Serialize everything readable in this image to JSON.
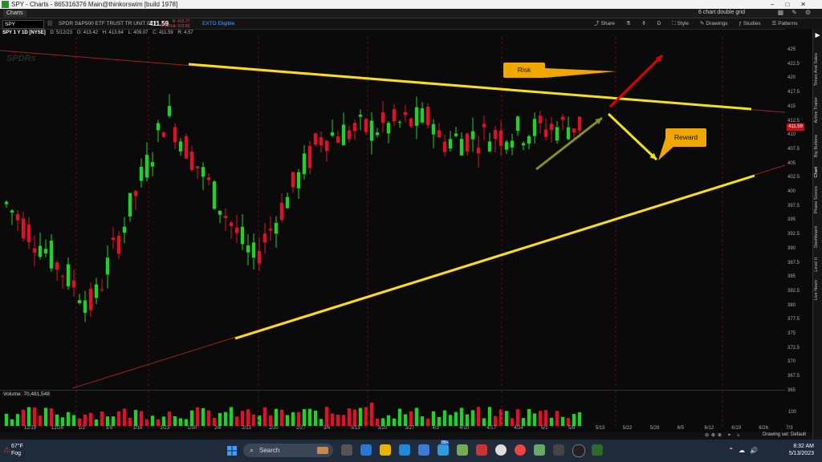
{
  "window": {
    "title": "SPY - Charts - 865316376 Main@thinkorswim [build 1978]",
    "controls": [
      "–",
      "□",
      "✕"
    ]
  },
  "tabs": {
    "active": "Charts",
    "grid_label": "6 chart double grid"
  },
  "toolbar": {
    "symbol": "SPY",
    "description": "SPDR S&P500 ETF TRUST TR UNIT ETF",
    "last_price": "411.59",
    "bid": "B: 410.77",
    "ask": "A: 410.80",
    "change": "-1.13%",
    "ext_label": "EXTO Eligible",
    "share": "Share",
    "period_code": "D",
    "style": "Style",
    "drawings": "Drawings",
    "studies": "Studies",
    "patterns": "Patterns"
  },
  "info_line": {
    "label": "SPY 1 Y 1D [NYSE]",
    "date": "D: 5/12/23",
    "open": "O: 413.42",
    "high": "H: 413.64",
    "low": "L: 409.07",
    "close": "C: 411.59",
    "range": "R: 4.57"
  },
  "watermark": "SPDRs",
  "callouts": {
    "risk": "Risk",
    "reward": "Reward"
  },
  "price_tag": "411.59",
  "y_axis": [
    "425",
    "422.5",
    "420",
    "417.5",
    "415",
    "412.5",
    "410",
    "407.5",
    "405",
    "402.5",
    "400",
    "397.5",
    "395",
    "392.5",
    "390",
    "387.5",
    "385",
    "382.5",
    "380",
    "377.5",
    "375",
    "372.5",
    "370",
    "367.5",
    "365"
  ],
  "volume": {
    "label": "Volume",
    "value": "70,481,548",
    "axis_label": "100"
  },
  "x_axis": [
    "12/19",
    "12/26",
    "1/2",
    "1/9",
    "1/16",
    "1/23",
    "1/30",
    "2/6",
    "2/13",
    "2/20",
    "2/27",
    "3/6",
    "3/13",
    "3/20",
    "3/27",
    "4/3",
    "4/10",
    "4/17",
    "4/24",
    "5/1",
    "5/8",
    "5/15",
    "5/22",
    "5/29",
    "6/5",
    "6/12",
    "6/19",
    "6/26",
    "7/3"
  ],
  "bottom_bar": {
    "drawing_set": "Drawing set: Default"
  },
  "right_tabs": [
    "Times And Sales",
    "Active Trader",
    "Big Buttons",
    "Chart",
    "Phase Scores",
    "Dashboard",
    "Level II",
    "Live News"
  ],
  "taskbar": {
    "temperature": "67°F",
    "weather": "Fog",
    "search": "Search",
    "time": "8:32 AM",
    "date": "5/13/2023",
    "badge": "99+"
  },
  "colors": {
    "up": "#1fd12a",
    "down": "#e0102a",
    "trendline": "#f5e11a",
    "accent_orange": "#f0a800",
    "risk_arrow": "#e00000",
    "momentum_arrow": "#8a8f1f"
  }
}
